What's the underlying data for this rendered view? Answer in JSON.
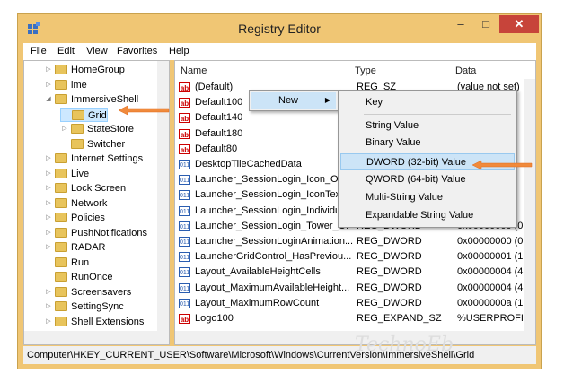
{
  "window": {
    "title": "Registry Editor",
    "min": "–",
    "max": "□",
    "close": "✕"
  },
  "menu": [
    "File",
    "Edit",
    "View",
    "Favorites",
    "Help"
  ],
  "tree": [
    {
      "label": "HomeGroup",
      "indent": 1,
      "arrow": "▷"
    },
    {
      "label": "ime",
      "indent": 1,
      "arrow": "▷"
    },
    {
      "label": "ImmersiveShell",
      "indent": 1,
      "arrow": "◢"
    },
    {
      "label": "Grid",
      "indent": 2,
      "arrow": "",
      "selected": true
    },
    {
      "label": "StateStore",
      "indent": 2,
      "arrow": "▷"
    },
    {
      "label": "Switcher",
      "indent": 2,
      "arrow": ""
    },
    {
      "label": "Internet Settings",
      "indent": 1,
      "arrow": "▷"
    },
    {
      "label": "Live",
      "indent": 1,
      "arrow": "▷"
    },
    {
      "label": "Lock Screen",
      "indent": 1,
      "arrow": "▷"
    },
    {
      "label": "Network",
      "indent": 1,
      "arrow": "▷"
    },
    {
      "label": "Policies",
      "indent": 1,
      "arrow": "▷"
    },
    {
      "label": "PushNotifications",
      "indent": 1,
      "arrow": "▷"
    },
    {
      "label": "RADAR",
      "indent": 1,
      "arrow": "▷"
    },
    {
      "label": "Run",
      "indent": 1,
      "arrow": ""
    },
    {
      "label": "RunOnce",
      "indent": 1,
      "arrow": ""
    },
    {
      "label": "Screensavers",
      "indent": 1,
      "arrow": "▷"
    },
    {
      "label": "SettingSync",
      "indent": 1,
      "arrow": "▷"
    },
    {
      "label": "Shell Extensions",
      "indent": 1,
      "arrow": "▷"
    }
  ],
  "list": {
    "headers": {
      "name": "Name",
      "type": "Type",
      "data": "Data"
    },
    "rows": [
      {
        "icon": "ab",
        "name": "(Default)",
        "type": "REG_SZ",
        "data": "(value not set)"
      },
      {
        "icon": "ab",
        "name": "Default100",
        "type": "",
        "data": ""
      },
      {
        "icon": "ab",
        "name": "Default140",
        "type": "",
        "data": ""
      },
      {
        "icon": "ab",
        "name": "Default180",
        "type": "",
        "data": ""
      },
      {
        "icon": "ab",
        "name": "Default80",
        "type": "",
        "data": ""
      },
      {
        "icon": "011",
        "name": "DesktopTileCachedData",
        "type": "",
        "data": ""
      },
      {
        "icon": "011",
        "name": "Launcher_SessionLogin_Icon_Off",
        "type": "",
        "data": ""
      },
      {
        "icon": "011",
        "name": "Launcher_SessionLogin_IconText",
        "type": "",
        "data": ""
      },
      {
        "icon": "011",
        "name": "Launcher_SessionLogin_Individua",
        "type": "",
        "data": ""
      },
      {
        "icon": "011",
        "name": "Launcher_SessionLogin_Tower_Of",
        "type": "REG_DWORD",
        "data": "0x00000000 (0"
      },
      {
        "icon": "011",
        "name": "Launcher_SessionLoginAnimation...",
        "type": "REG_DWORD",
        "data": "0x00000000 (0"
      },
      {
        "icon": "011",
        "name": "LauncherGridControl_HasPreviou...",
        "type": "REG_DWORD",
        "data": "0x00000001 (1"
      },
      {
        "icon": "011",
        "name": "Layout_AvailableHeightCells",
        "type": "REG_DWORD",
        "data": "0x00000004 (4"
      },
      {
        "icon": "011",
        "name": "Layout_MaximumAvailableHeight...",
        "type": "REG_DWORD",
        "data": "0x00000004 (4"
      },
      {
        "icon": "011",
        "name": "Layout_MaximumRowCount",
        "type": "REG_DWORD",
        "data": "0x0000000a (1"
      },
      {
        "icon": "ab",
        "name": "Logo100",
        "type": "REG_EXPAND_SZ",
        "data": "%USERPROFI"
      }
    ]
  },
  "status": "Computer\\HKEY_CURRENT_USER\\Software\\Microsoft\\Windows\\CurrentVersion\\ImmersiveShell\\Grid",
  "context_menu": {
    "new_label": "New",
    "new_arrow": "▶"
  },
  "submenu": [
    "Key",
    "String Value",
    "Binary Value",
    "DWORD (32-bit) Value",
    "QWORD (64-bit) Value",
    "Multi-String Value",
    "Expandable String Value"
  ],
  "watermark": "TechnoEb",
  "accent_color": "#f0c674"
}
